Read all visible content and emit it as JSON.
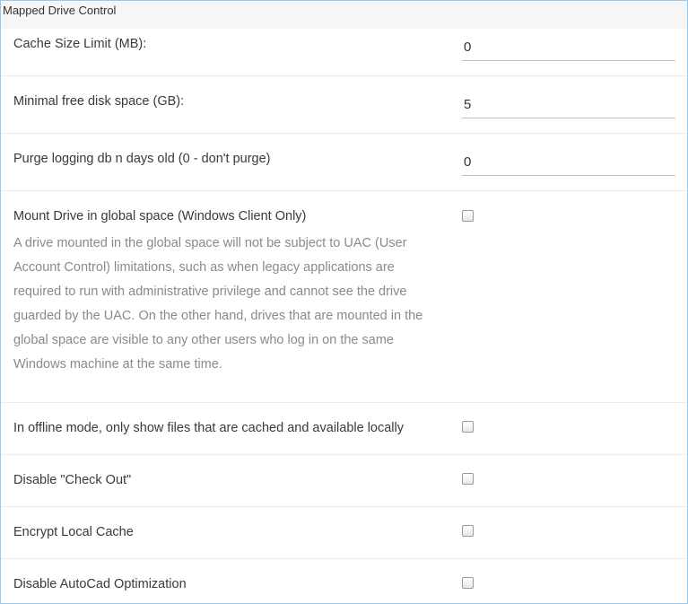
{
  "panel": {
    "title": "Mapped Drive Control"
  },
  "fields": {
    "cache_size": {
      "label": "Cache Size Limit (MB):",
      "value": "0"
    },
    "min_free": {
      "label": "Minimal free disk space (GB):",
      "value": "5"
    },
    "purge_logging": {
      "label": "Purge logging db n days old (0 - don't purge)",
      "value": "0"
    }
  },
  "options": {
    "global_space": {
      "label": "Mount Drive in global space (Windows Client Only)",
      "description": "A drive mounted in the global space will not be subject to UAC (User Account Control) limitations, such as when legacy applications are required to run with administrative privilege and cannot see the drive guarded by the UAC. On the other hand, drives that are mounted in the global space are visible to any other users who log in on the same Windows machine at the same time.",
      "checked": false
    },
    "offline_cached": {
      "label": "In offline mode, only show files that are cached and available locally",
      "checked": false
    },
    "disable_checkout": {
      "label": "Disable \"Check Out\"",
      "checked": false
    },
    "encrypt_cache": {
      "label": "Encrypt Local Cache",
      "checked": false
    },
    "disable_autocad": {
      "label": "Disable AutoCad Optimization",
      "checked": false
    }
  }
}
